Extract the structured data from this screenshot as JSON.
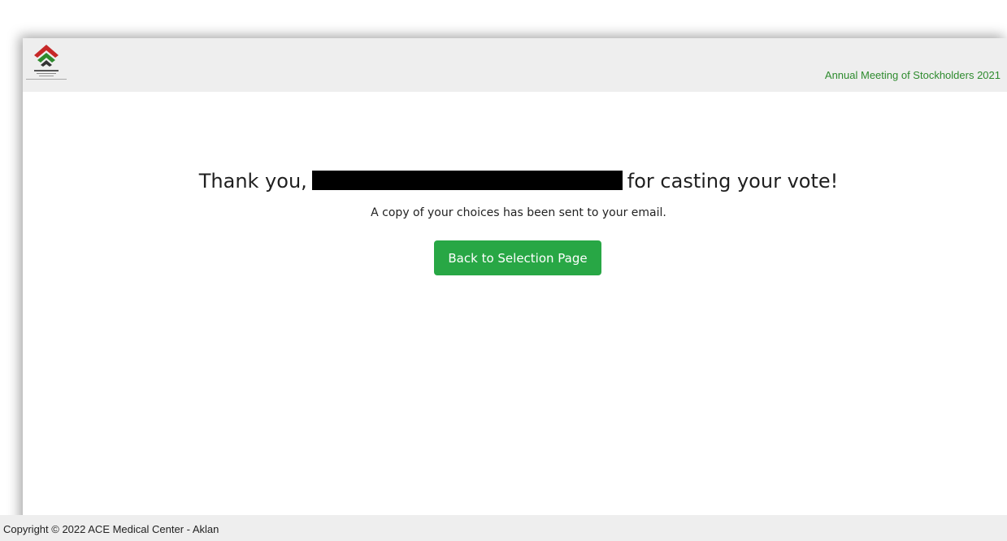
{
  "header": {
    "meeting_title": "Annual Meeting of Stockholders 2021",
    "logo_icon": "asia-pacific-logo",
    "brand_colors": {
      "red": "#c62828",
      "green": "#2e8b2e"
    }
  },
  "main": {
    "thanks_prefix": "Thank you,",
    "thanks_suffix": "for casting your vote!",
    "subtext": "A copy of your choices has been sent to your email.",
    "back_button_label": "Back to Selection Page",
    "button_color": "#28a745"
  },
  "footer": {
    "copyright": "Copyright © 2022 ACE Medical Center - Aklan"
  }
}
